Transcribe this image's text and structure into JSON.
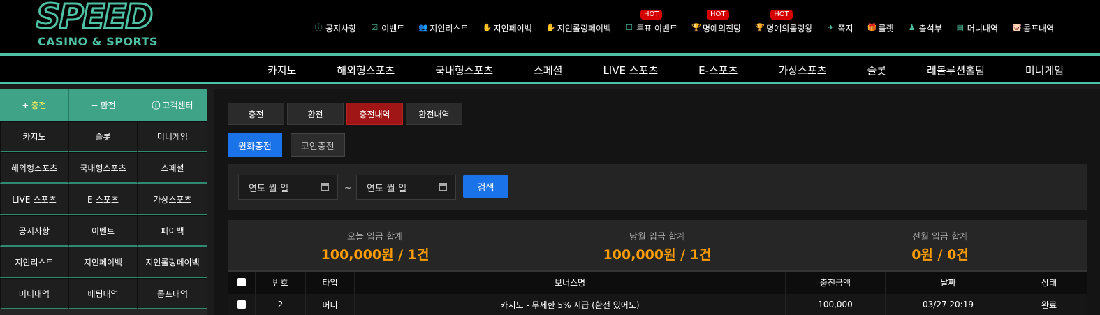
{
  "logo": {
    "title": "SPEED",
    "subtitle": "CASINO & SPORTS"
  },
  "top_nav": [
    {
      "label": "공지사항",
      "icon": "info-circle-icon",
      "glyph": "ⓘ"
    },
    {
      "label": "이벤트",
      "icon": "calendar-check-icon",
      "glyph": "☑"
    },
    {
      "label": "지인리스트",
      "icon": "users-icon",
      "glyph": "👥"
    },
    {
      "label": "지인페이백",
      "icon": "hand-coin-icon",
      "glyph": "✋"
    },
    {
      "label": "지인롤링페이백",
      "icon": "hand-coin-icon",
      "glyph": "✋"
    },
    {
      "label": "투표 이벤트",
      "icon": "vote-icon",
      "glyph": "☐",
      "badge": "HOT"
    },
    {
      "label": "명예의전당",
      "icon": "trophy-icon",
      "glyph": "🏆",
      "badge": "HOT"
    },
    {
      "label": "명예의롤링왕",
      "icon": "trophy-icon",
      "glyph": "🏆",
      "badge": "HOT"
    },
    {
      "label": "쪽지",
      "icon": "paper-plane-icon",
      "glyph": "✈"
    },
    {
      "label": "룰렛",
      "icon": "gift-icon",
      "glyph": "🎁"
    },
    {
      "label": "출석부",
      "icon": "stamp-icon",
      "glyph": "♟"
    },
    {
      "label": "머니내역",
      "icon": "clipboard-icon",
      "glyph": "▤"
    },
    {
      "label": "콤프내역",
      "icon": "piggy-bank-icon",
      "glyph": "🐷"
    }
  ],
  "main_nav": [
    "카지노",
    "해외형스포츠",
    "국내형스포츠",
    "스페셜",
    "LIVE 스포츠",
    "E-스포츠",
    "가상스포츠",
    "슬롯",
    "레볼루션홀덤",
    "미니게임"
  ],
  "sidebar": {
    "top_buttons": [
      {
        "symbol": "+",
        "label": "충전"
      },
      {
        "symbol": "−",
        "label": "환전"
      },
      {
        "symbol": "ⓘ",
        "label": "고객센터"
      }
    ],
    "grid": [
      "카지노",
      "슬롯",
      "미니게임",
      "해외형스포츠",
      "국내형스포츠",
      "스페셜",
      "LIVE-스포츠",
      "E-스포츠",
      "가상스포츠",
      "공지사항",
      "이벤트",
      "페이백",
      "지인리스트",
      "지인페이백",
      "지인롤링페이백",
      "머니내역",
      "베팅내역",
      "콤프내역"
    ]
  },
  "tabs": [
    "충전",
    "환전",
    "충전내역",
    "환전내역"
  ],
  "active_tab": "충전내역",
  "subtabs": [
    "원화충전",
    "코인충전"
  ],
  "search": {
    "date_from": "연도-월-일",
    "tilde": "~",
    "date_to": "연도-월-일",
    "button": "검색"
  },
  "summary": [
    {
      "label": "오늘 입금 합계",
      "value": "100,000원 / 1건"
    },
    {
      "label": "당월 입금 합계",
      "value": "100,000원 / 1건"
    },
    {
      "label": "전월 입금 합계",
      "value": "0원 / 0건"
    }
  ],
  "table": {
    "headers": [
      "번호",
      "타입",
      "보너스명",
      "충전금액",
      "날짜",
      "상태"
    ],
    "rows": [
      [
        "2",
        "머니",
        "카지노 - 무제한 5% 지급 (환전 있어도)",
        "100,000",
        "03/27 20:19",
        "완료"
      ]
    ]
  },
  "colors": {
    "accent": "#4fc1a4",
    "active_tab": "#a01616",
    "primary": "#1a73e8",
    "amount": "#ff9d00",
    "hot": "#d40000"
  }
}
